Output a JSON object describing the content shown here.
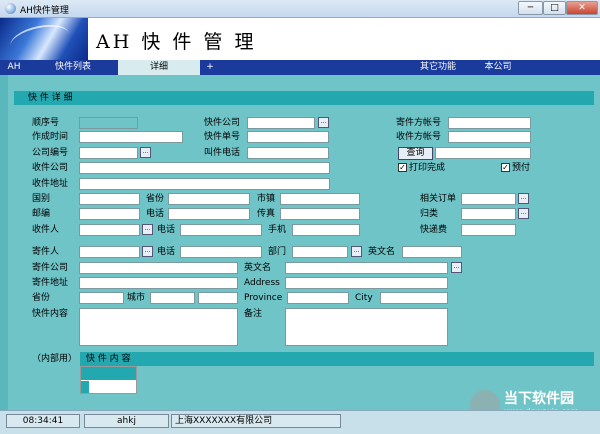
{
  "window": {
    "title": "AH快件管理",
    "min": "─",
    "max": "□",
    "close": "✕"
  },
  "banner": {
    "app_name": "AH 快 件 管 理"
  },
  "tabs": [
    "AH",
    "快件列表",
    "详细",
    "+",
    "其它功能",
    "本公司"
  ],
  "panel_title": "快 件 详 细",
  "form": {
    "seq": "顺序号",
    "created": "作成时间",
    "company_code": "公司编号",
    "recv_company": "收件公司",
    "recv_address": "收件地址",
    "country": "国别",
    "province": "省份",
    "city": "市镇",
    "related_order": "相关订单",
    "zip": "邮编",
    "phone": "电话",
    "fax": "传真",
    "category": "归类",
    "receiver": "收件人",
    "phone2": "电话",
    "mobile": "手机",
    "fee": "快递费",
    "express_company": "快件公司",
    "express_no": "快件单号",
    "call_phone": "叫件电话",
    "sender_acct": "寄件方帐号",
    "recv_acct": "收件方帐号",
    "query": "查询",
    "printed": "打印完成",
    "prepaid": "预付",
    "sender": "寄件人",
    "phone3": "电话",
    "dept": "部门",
    "en_name": "英文名",
    "sender_company": "寄件公司",
    "en_name2": "英文名",
    "sender_address": "寄件地址",
    "address_en": "Address",
    "province2": "省份",
    "city2": "城市",
    "province_en": "Province",
    "city_en": "City",
    "content": "快件内容",
    "remark": "备注",
    "internal": "（内部用）"
  },
  "grid_title": "快 件 内 容",
  "status": {
    "time": "08:34:41",
    "user": "ahkj",
    "company": "上海XXXXXXX有限公司"
  },
  "watermark": {
    "main": "当下软件园",
    "url": "www.downxia.com"
  }
}
